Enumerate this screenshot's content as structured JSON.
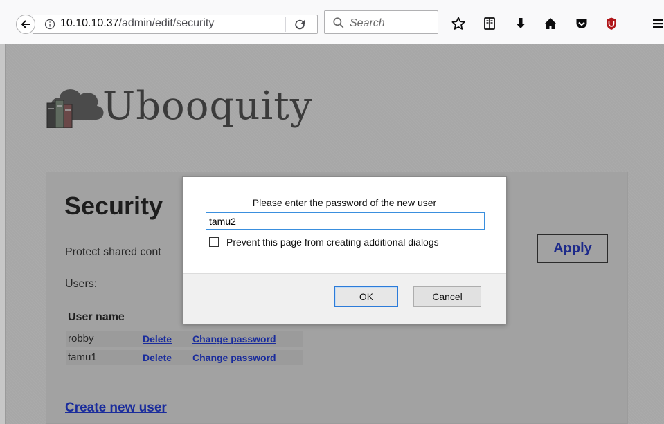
{
  "browser": {
    "url_host": "10.10.10.37",
    "url_path": "/admin/edit/security",
    "search_placeholder": "Search"
  },
  "page": {
    "logo_text": "Ubooquity",
    "section_title": "Security",
    "protect_text": "Protect shared cont",
    "users_label": "Users:",
    "apply_label": "Apply",
    "table_header_username": "User name",
    "users": [
      {
        "name": "robby",
        "delete_label": "Delete",
        "change_password_label": "Change password"
      },
      {
        "name": "tamu1",
        "delete_label": "Delete",
        "change_password_label": "Change password"
      }
    ],
    "create_user_label": "Create new user"
  },
  "dialog": {
    "message": "Please enter the password of the new user",
    "input_value": "tamu2",
    "checkbox_label": "Prevent this page from creating additional dialogs",
    "checkbox_checked": false,
    "ok_label": "OK",
    "cancel_label": "Cancel"
  },
  "icons": [
    "back-arrow-icon",
    "info-icon",
    "reload-icon",
    "search-icon",
    "bookmark-star-icon",
    "reader-view-icon",
    "download-icon",
    "home-icon",
    "pocket-icon",
    "ublock-icon",
    "menu-icon",
    "book-cloud-logo-icon"
  ],
  "colors": {
    "link": "#1a2c9c",
    "page_bg": "#a7a7a7",
    "input_focus": "#3a8fde"
  }
}
